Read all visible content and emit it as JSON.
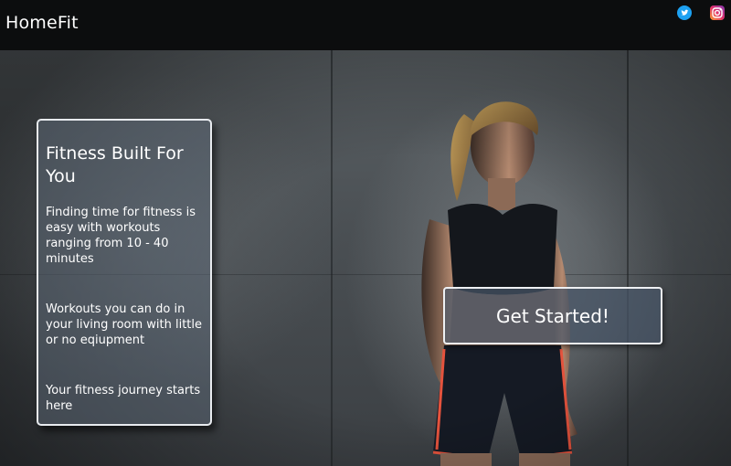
{
  "header": {
    "brand": "HomeFit",
    "social": [
      {
        "icon": "twitter-icon",
        "color": "#1da1f2"
      },
      {
        "icon": "instagram-icon",
        "color": "#c13584"
      }
    ]
  },
  "hero": {
    "card": {
      "title": "Fitness Built For You",
      "paragraphs": [
        "Finding time for fitness is easy with workouts ranging from 10 - 40 minutes",
        "Workouts you can do in your living room with little or no eqiupment",
        "Your fitness journey starts here"
      ]
    },
    "cta_label": "Get Started!"
  },
  "colors": {
    "navbar": "#0c0d0e",
    "card_border": "#e8ebef",
    "accent_shorts_trim": "#e5533d"
  }
}
